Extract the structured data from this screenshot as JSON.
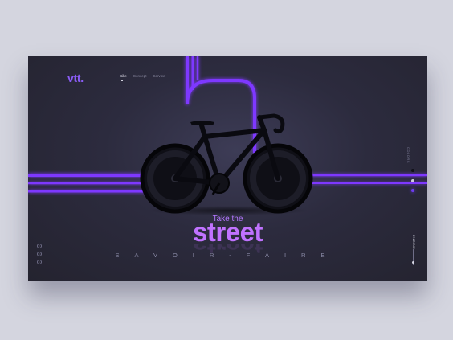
{
  "brand": {
    "logo": "vtt."
  },
  "nav": {
    "items": [
      {
        "label": "Bike",
        "active": true
      },
      {
        "label": "Concept",
        "active": false
      },
      {
        "label": "Service",
        "active": false
      }
    ]
  },
  "hero": {
    "kicker": "Take the",
    "headline": "street",
    "tagline": "SAVOIR-FAIRE"
  },
  "side": {
    "colors_label": "COLORS",
    "engine_label": "ENGINE"
  },
  "swatches": [
    {
      "name": "black",
      "color": "#111118",
      "selected": false
    },
    {
      "name": "white",
      "color": "#cfcfdb",
      "selected": false
    },
    {
      "name": "purple",
      "color": "#6d3cf0",
      "selected": true
    }
  ],
  "social": [
    {
      "icon": "facebook-icon",
      "glyph": "f"
    },
    {
      "icon": "instagram-icon",
      "glyph": "◎"
    },
    {
      "icon": "pinterest-icon",
      "glyph": "p"
    }
  ],
  "theme": {
    "accent": "#8a3ffc",
    "headline": "#c072ff",
    "background": "#2b2a3d"
  }
}
